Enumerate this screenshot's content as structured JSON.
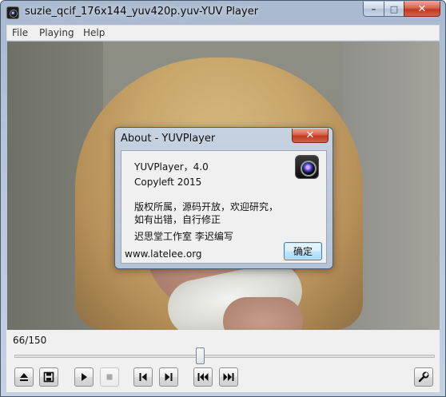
{
  "window": {
    "title": "suzie_qcif_176x144_yuv420p.yuv-YUV Player",
    "controls": {
      "minimize": "–",
      "maximize": "□",
      "close": "✕"
    }
  },
  "menubar": {
    "items": [
      "File",
      "Playing",
      "Help"
    ]
  },
  "player": {
    "frame_counter": "66/150",
    "progress": {
      "current_frame": 66,
      "total_frames": 150
    },
    "buttons": [
      "eject-icon",
      "save-icon",
      "play-icon",
      "stop-icon",
      "prev-frame-icon",
      "next-frame-icon",
      "first-frame-icon",
      "last-frame-icon",
      "settings-wrench-icon"
    ]
  },
  "about_dialog": {
    "title": "About - YUVPlayer",
    "close": "✕",
    "version": "YUVPlayer，4.0",
    "copyleft": "Copyleft 2015",
    "license_line1": "版权所属，源码开放，欢迎研究，",
    "license_line2": "如有出错，自行修正",
    "author": "迟思堂工作室 李迟编写",
    "website": "www.latelee.org",
    "ok_label": "确定",
    "icon": "camera-lens-icon"
  }
}
